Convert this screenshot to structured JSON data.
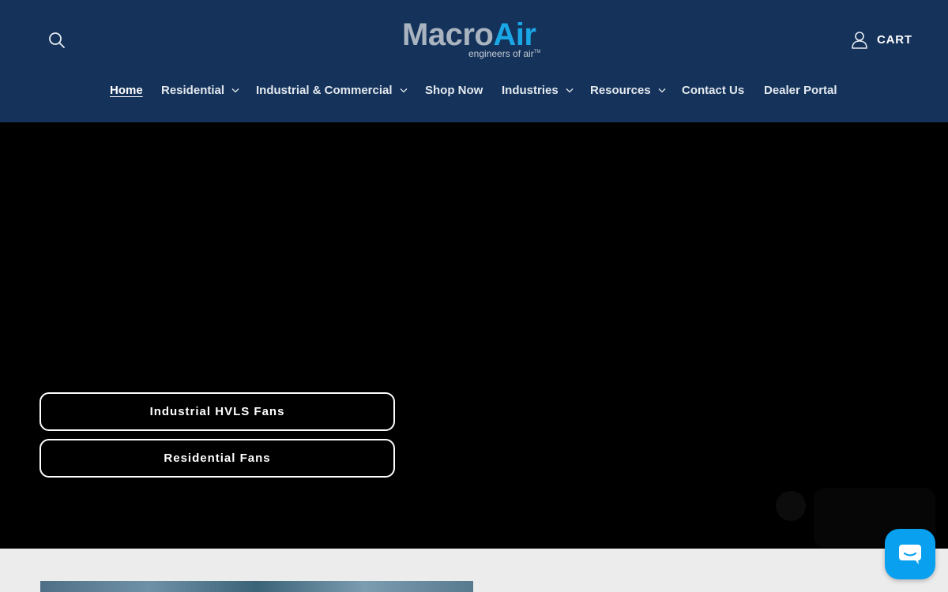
{
  "header": {
    "logo": {
      "main_left": "Macro",
      "main_right": "Air",
      "tagline": "engineers of air",
      "tm": "TM"
    },
    "cart_label": "CART",
    "icons": {
      "search": "search-icon",
      "account": "account-icon",
      "chat": "chat-icon"
    },
    "colors": {
      "header_bg": "#14325a",
      "logo_accent": "#1aa7e6",
      "chat_button": "#0aa0f0"
    }
  },
  "nav": {
    "items": [
      {
        "label": "Home",
        "active": true,
        "dropdown": false
      },
      {
        "label": "Residential",
        "dropdown": true
      },
      {
        "label": "Industrial & Commercial",
        "dropdown": true
      },
      {
        "label": "Shop Now",
        "dropdown": false
      },
      {
        "label": "Industries",
        "dropdown": true
      },
      {
        "label": "Resources",
        "dropdown": true
      },
      {
        "label": "Contact Us",
        "dropdown": false
      },
      {
        "label": "Dealer Portal",
        "dropdown": false
      }
    ]
  },
  "hero": {
    "buttons": [
      {
        "label": "Industrial HVLS Fans"
      },
      {
        "label": "Residential Fans"
      }
    ]
  }
}
